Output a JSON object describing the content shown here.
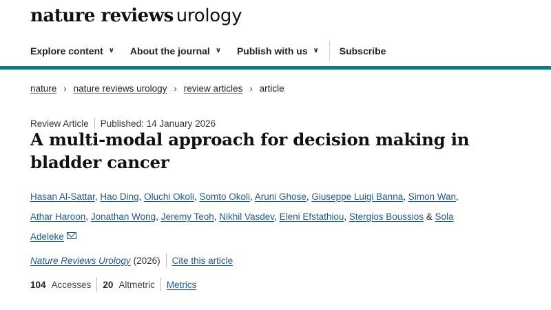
{
  "masthead": {
    "brand_bold": "nature reviews",
    "brand_light": "urology"
  },
  "nav": {
    "items": [
      {
        "label": "Explore content"
      },
      {
        "label": "About the journal"
      },
      {
        "label": "Publish with us"
      }
    ],
    "subscribe": "Subscribe"
  },
  "breadcrumb": {
    "items": [
      "nature",
      "nature reviews urology",
      "review articles"
    ],
    "current": "article",
    "separator": "›"
  },
  "article": {
    "type": "Review Article",
    "published": "Published: 14 January 2026",
    "title": "A multi-modal approach for decision making in bladder cancer",
    "authors_line1": [
      "Hasan Al-Sattar",
      "Hao Ding",
      "Oluchi Okoli",
      "Somto Okoli",
      "Aruni Ghose",
      "Giuseppe Luigi Banna",
      "Simon Wan"
    ],
    "authors_line2": [
      "Athar Haroon",
      "Jonathan Wong",
      "Jeremy Teoh",
      "Nikhil Vasdev",
      "Eleni Efstathiou",
      "Stergios Boussios"
    ],
    "last_author_first": "Sola",
    "last_author_rest": "Adeleke",
    "ampersand": "&",
    "comma": ",",
    "journal": "Nature Reviews Urology",
    "year": "(2026)",
    "cite": "Cite this article",
    "accesses_count": "104",
    "accesses_label": "Accesses",
    "altmetric_count": "20",
    "altmetric_label": "Altmetric",
    "metrics_link": "Metrics"
  },
  "colors": {
    "accent_teal": "#0f7b7d",
    "link_blue": "#1a5a9a"
  },
  "icons": {
    "nav_chevron": "chevron-down-icon",
    "breadcrumb_sep": "chevron-right-icon",
    "author_contact": "mail-icon"
  }
}
